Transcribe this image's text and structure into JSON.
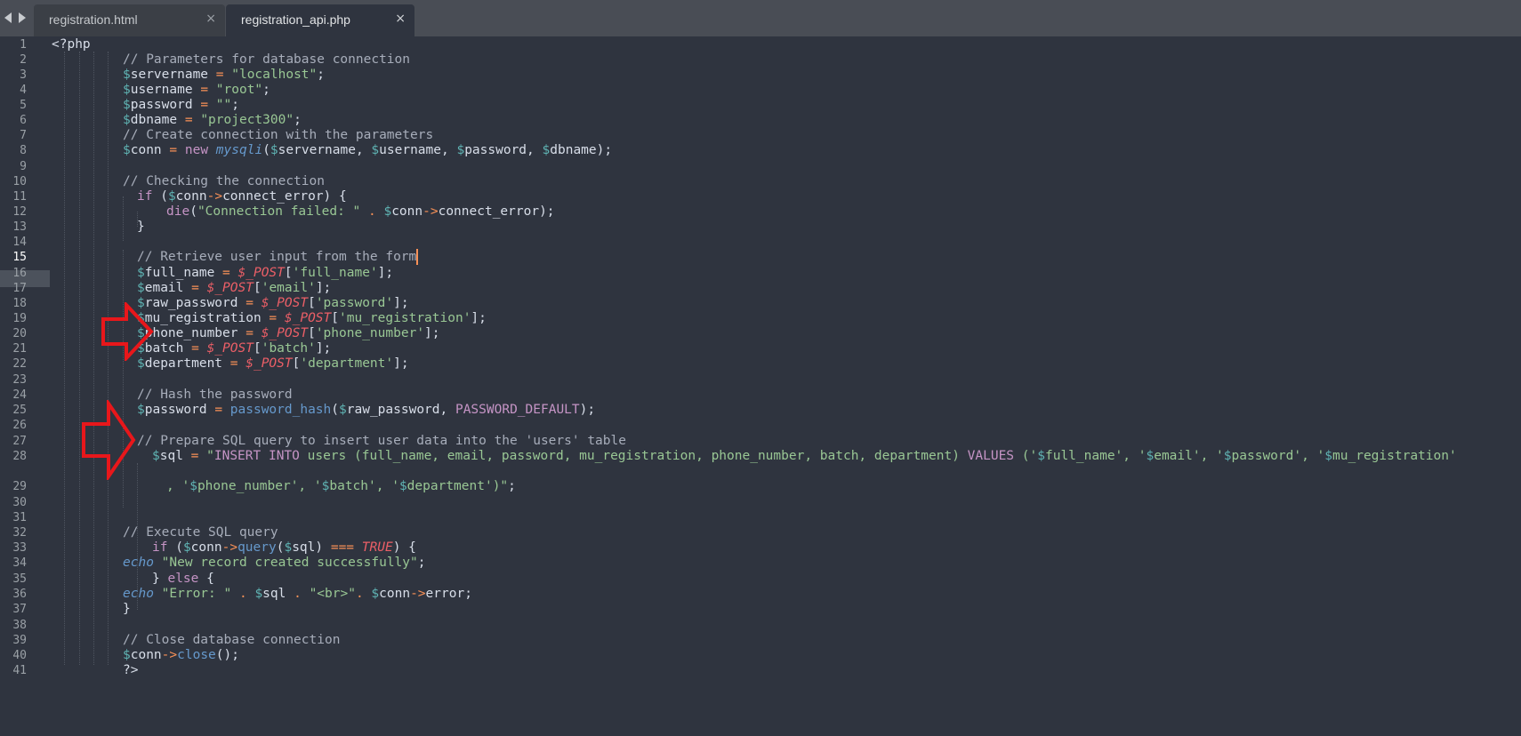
{
  "tabs": [
    {
      "label": "registration.html",
      "close": "×"
    },
    {
      "label": "registration_api.php",
      "close": "×"
    }
  ],
  "editor": {
    "active_line": "15",
    "line_numbers": [
      "1",
      "2",
      "3",
      "4",
      "5",
      "6",
      "7",
      "8",
      "9",
      "10",
      "11",
      "12",
      "13",
      "14",
      "15",
      "16",
      "17",
      "18",
      "19",
      "20",
      "21",
      "22",
      "23",
      "24",
      "25",
      "26",
      "27",
      "28",
      "29",
      "30",
      "31",
      "32",
      "33",
      "34",
      "35",
      "36",
      "37",
      "38",
      "39",
      "40",
      "41"
    ],
    "lines": [
      [
        [
          "pl",
          "<?php"
        ]
      ],
      [
        [
          "cm",
          "// Parameters for database connection"
        ]
      ],
      [
        [
          "v",
          "$"
        ],
        [
          "pl",
          "servername "
        ],
        [
          "op",
          "="
        ],
        [
          "pl",
          " "
        ],
        [
          "str",
          "\"localhost\""
        ],
        [
          "pl",
          ";"
        ]
      ],
      [
        [
          "v",
          "$"
        ],
        [
          "pl",
          "username "
        ],
        [
          "op",
          "="
        ],
        [
          "pl",
          " "
        ],
        [
          "str",
          "\"root\""
        ],
        [
          "pl",
          ";"
        ]
      ],
      [
        [
          "v",
          "$"
        ],
        [
          "pl",
          "password "
        ],
        [
          "op",
          "="
        ],
        [
          "pl",
          " "
        ],
        [
          "str",
          "\"\""
        ],
        [
          "pl",
          ";"
        ]
      ],
      [
        [
          "v",
          "$"
        ],
        [
          "pl",
          "dbname "
        ],
        [
          "op",
          "="
        ],
        [
          "pl",
          " "
        ],
        [
          "str",
          "\"project300\""
        ],
        [
          "pl",
          ";"
        ]
      ],
      [
        [
          "cm",
          "// Create connection with the parameters"
        ]
      ],
      [
        [
          "v",
          "$"
        ],
        [
          "pl",
          "conn "
        ],
        [
          "op",
          "="
        ],
        [
          "pl",
          " "
        ],
        [
          "kw",
          "new"
        ],
        [
          "pl",
          " "
        ],
        [
          "fn",
          "mysqli"
        ],
        [
          "pl",
          "("
        ],
        [
          "v",
          "$"
        ],
        [
          "pl",
          "servername, "
        ],
        [
          "v",
          "$"
        ],
        [
          "pl",
          "username, "
        ],
        [
          "v",
          "$"
        ],
        [
          "pl",
          "password, "
        ],
        [
          "v",
          "$"
        ],
        [
          "pl",
          "dbname);"
        ]
      ],
      [],
      [
        [
          "cm",
          "// Checking the connection"
        ]
      ],
      [
        [
          "kw",
          "if"
        ],
        [
          "pl",
          " ("
        ],
        [
          "v",
          "$"
        ],
        [
          "pl",
          "conn"
        ],
        [
          "op",
          "->"
        ],
        [
          "pl",
          "connect_error) {"
        ]
      ],
      [
        [
          "kw",
          "die"
        ],
        [
          "pl",
          "("
        ],
        [
          "str",
          "\"Connection failed: \""
        ],
        [
          "pl",
          " "
        ],
        [
          "op",
          "."
        ],
        [
          "pl",
          " "
        ],
        [
          "v",
          "$"
        ],
        [
          "pl",
          "conn"
        ],
        [
          "op",
          "->"
        ],
        [
          "pl",
          "connect_error);"
        ]
      ],
      [
        [
          "pl",
          "}"
        ]
      ],
      [],
      [
        [
          "cm",
          "// Retrieve user input from the form"
        ]
      ],
      [
        [
          "v",
          "$"
        ],
        [
          "pl",
          "full_name "
        ],
        [
          "op",
          "="
        ],
        [
          "pl",
          " "
        ],
        [
          "sg",
          "$_POST"
        ],
        [
          "pl",
          "["
        ],
        [
          "str",
          "'full_name'"
        ],
        [
          "pl",
          "];"
        ]
      ],
      [
        [
          "v",
          "$"
        ],
        [
          "pl",
          "email "
        ],
        [
          "op",
          "="
        ],
        [
          "pl",
          " "
        ],
        [
          "sg",
          "$_POST"
        ],
        [
          "pl",
          "["
        ],
        [
          "str",
          "'email'"
        ],
        [
          "pl",
          "];"
        ]
      ],
      [
        [
          "v",
          "$"
        ],
        [
          "pl",
          "raw_password "
        ],
        [
          "op",
          "="
        ],
        [
          "pl",
          " "
        ],
        [
          "sg",
          "$_POST"
        ],
        [
          "pl",
          "["
        ],
        [
          "str",
          "'password'"
        ],
        [
          "pl",
          "];"
        ]
      ],
      [
        [
          "v",
          "$"
        ],
        [
          "pl",
          "mu_registration "
        ],
        [
          "op",
          "="
        ],
        [
          "pl",
          " "
        ],
        [
          "sg",
          "$_POST"
        ],
        [
          "pl",
          "["
        ],
        [
          "str",
          "'mu_registration'"
        ],
        [
          "pl",
          "];"
        ]
      ],
      [
        [
          "v",
          "$"
        ],
        [
          "pl",
          "phone_number "
        ],
        [
          "op",
          "="
        ],
        [
          "pl",
          " "
        ],
        [
          "sg",
          "$_POST"
        ],
        [
          "pl",
          "["
        ],
        [
          "str",
          "'phone_number'"
        ],
        [
          "pl",
          "];"
        ]
      ],
      [
        [
          "v",
          "$"
        ],
        [
          "pl",
          "batch "
        ],
        [
          "op",
          "="
        ],
        [
          "pl",
          " "
        ],
        [
          "sg",
          "$_POST"
        ],
        [
          "pl",
          "["
        ],
        [
          "str",
          "'batch'"
        ],
        [
          "pl",
          "];"
        ]
      ],
      [
        [
          "v",
          "$"
        ],
        [
          "pl",
          "department "
        ],
        [
          "op",
          "="
        ],
        [
          "pl",
          " "
        ],
        [
          "sg",
          "$_POST"
        ],
        [
          "pl",
          "["
        ],
        [
          "str",
          "'department'"
        ],
        [
          "pl",
          "];"
        ]
      ],
      [],
      [
        [
          "cm",
          "// Hash the password"
        ]
      ],
      [
        [
          "v",
          "$"
        ],
        [
          "pl",
          "password "
        ],
        [
          "op",
          "="
        ],
        [
          "pl",
          " "
        ],
        [
          "fnn",
          "password_hash"
        ],
        [
          "pl",
          "("
        ],
        [
          "v",
          "$"
        ],
        [
          "pl",
          "raw_password, "
        ],
        [
          "kw",
          "PASSWORD_DEFAULT"
        ],
        [
          "pl",
          ");"
        ]
      ],
      [],
      [
        [
          "cm",
          "// Prepare SQL query to insert user data into the 'users' table"
        ]
      ],
      [
        [
          "v",
          "$"
        ],
        [
          "pl",
          "sql "
        ],
        [
          "op",
          "="
        ],
        [
          "pl",
          " "
        ],
        [
          "str",
          "\""
        ],
        [
          "kw",
          "INSERT INTO"
        ],
        [
          "str",
          " users (full_name, email, password, mu_registration, phone_number, batch, department) "
        ],
        [
          "kw",
          "VALUES"
        ],
        [
          "str",
          " ('"
        ],
        [
          "v",
          "$"
        ],
        [
          "str",
          "full_name', '"
        ],
        [
          "v",
          "$"
        ],
        [
          "str",
          "email', '"
        ],
        [
          "v",
          "$"
        ],
        [
          "str",
          "password', '"
        ],
        [
          "v",
          "$"
        ],
        [
          "str",
          "mu_registration'"
        ]
      ],
      [
        [
          "str",
          ", '"
        ],
        [
          "v",
          "$"
        ],
        [
          "str",
          "phone_number', '"
        ],
        [
          "v",
          "$"
        ],
        [
          "str",
          "batch', '"
        ],
        [
          "v",
          "$"
        ],
        [
          "str",
          "department')\""
        ],
        [
          "pl",
          ";"
        ]
      ],
      [],
      [],
      [
        [
          "cm",
          "// Execute SQL query"
        ]
      ],
      [
        [
          "kw",
          "if"
        ],
        [
          "pl",
          " ("
        ],
        [
          "v",
          "$"
        ],
        [
          "pl",
          "conn"
        ],
        [
          "op",
          "->"
        ],
        [
          "fnn",
          "query"
        ],
        [
          "pl",
          "("
        ],
        [
          "v",
          "$"
        ],
        [
          "pl",
          "sql) "
        ],
        [
          "op",
          "==="
        ],
        [
          "pl",
          " "
        ],
        [
          "sg",
          "TRUE"
        ],
        [
          "pl",
          ") {"
        ]
      ],
      [
        [
          "fn",
          "echo"
        ],
        [
          "pl",
          " "
        ],
        [
          "str",
          "\"New record created successfully\""
        ],
        [
          "pl",
          ";"
        ]
      ],
      [
        [
          "pl",
          "} "
        ],
        [
          "kw",
          "else"
        ],
        [
          "pl",
          " {"
        ]
      ],
      [
        [
          "fn",
          "echo"
        ],
        [
          "pl",
          " "
        ],
        [
          "str",
          "\"Error: \""
        ],
        [
          "pl",
          " "
        ],
        [
          "op",
          "."
        ],
        [
          "pl",
          " "
        ],
        [
          "v",
          "$"
        ],
        [
          "pl",
          "sql "
        ],
        [
          "op",
          "."
        ],
        [
          "pl",
          " "
        ],
        [
          "str",
          "\"<br>\""
        ],
        [
          "op",
          "."
        ],
        [
          "pl",
          " "
        ],
        [
          "v",
          "$"
        ],
        [
          "pl",
          "conn"
        ],
        [
          "op",
          "->"
        ],
        [
          "pl",
          "error;"
        ]
      ],
      [
        [
          "pl",
          "}"
        ]
      ],
      [],
      [
        [
          "cm",
          "// Close database connection"
        ]
      ],
      [
        [
          "v",
          "$"
        ],
        [
          "pl",
          "conn"
        ],
        [
          "op",
          "->"
        ],
        [
          "fnn",
          "close"
        ],
        [
          "pl",
          "();"
        ]
      ],
      [
        [
          "pl",
          "?>"
        ]
      ],
      []
    ]
  },
  "annotations": [
    {
      "name": "red-arrow-icon",
      "color": "#e8171b",
      "points_to_line": "18"
    },
    {
      "name": "red-arrow-icon",
      "color": "#e8171b",
      "points_to_line": "25"
    }
  ]
}
